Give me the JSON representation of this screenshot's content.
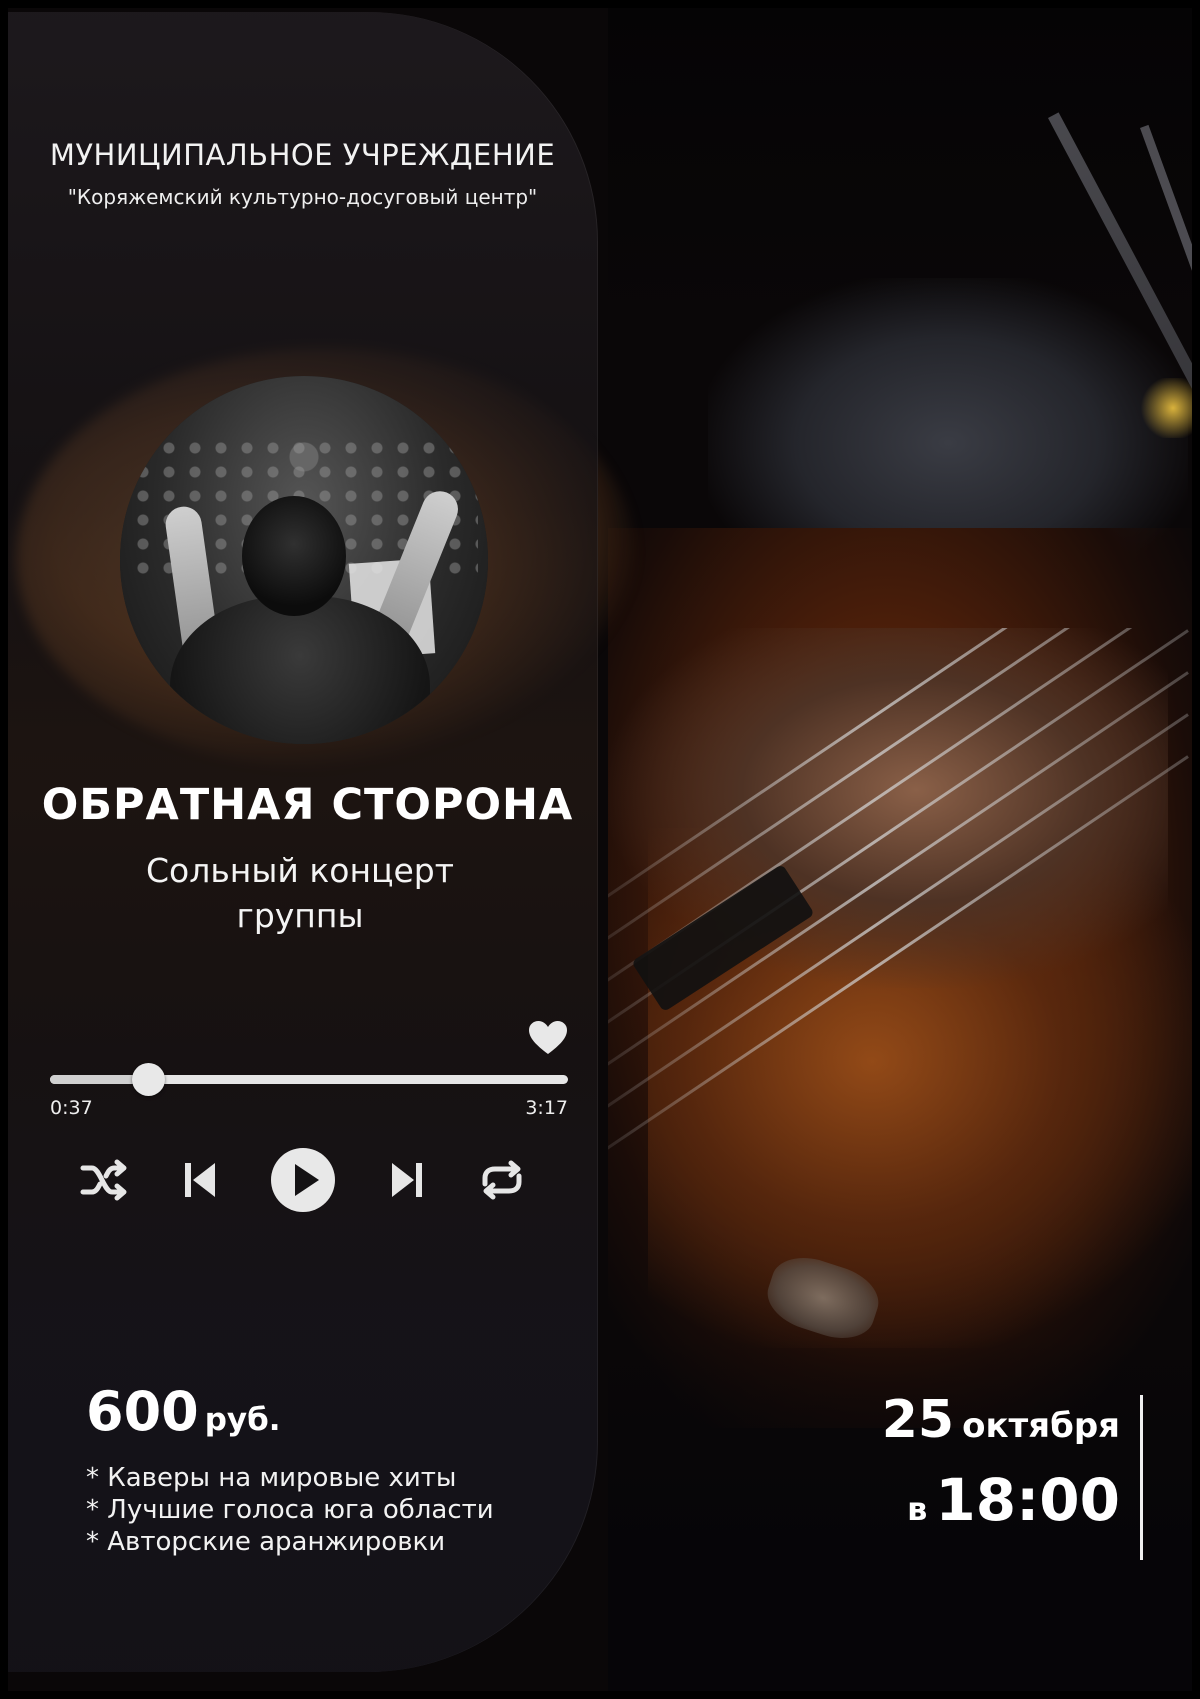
{
  "organization": {
    "title": "МУНИЦИПАЛЬНОЕ УЧРЕЖДЕНИЕ",
    "subtitle": "\"Коряжемский культурно-досуговый центр\""
  },
  "event": {
    "title": "ОБРАТНАЯ СТОРОНА",
    "subtitle_line1": "Сольный концерт",
    "subtitle_line2": "группы"
  },
  "player": {
    "current_time": "0:37",
    "total_time": "3:17",
    "progress": 0.19,
    "icons": [
      "heart-icon",
      "shuffle-icon",
      "previous-icon",
      "play-icon",
      "next-icon",
      "repeat-icon"
    ]
  },
  "price": {
    "amount": "600",
    "currency": "руб."
  },
  "features": [
    "* Каверы на мировые хиты",
    "* Лучшие голоса юга  области",
    "* Авторские аранжировки"
  ],
  "schedule": {
    "day": "25",
    "month": "октября",
    "preposition": "в",
    "time": "18:00"
  },
  "colors": {
    "background": "#0a0708",
    "text": "#ffffff",
    "accent_warm": "#7a3a12",
    "control": "#e6e6e6"
  }
}
